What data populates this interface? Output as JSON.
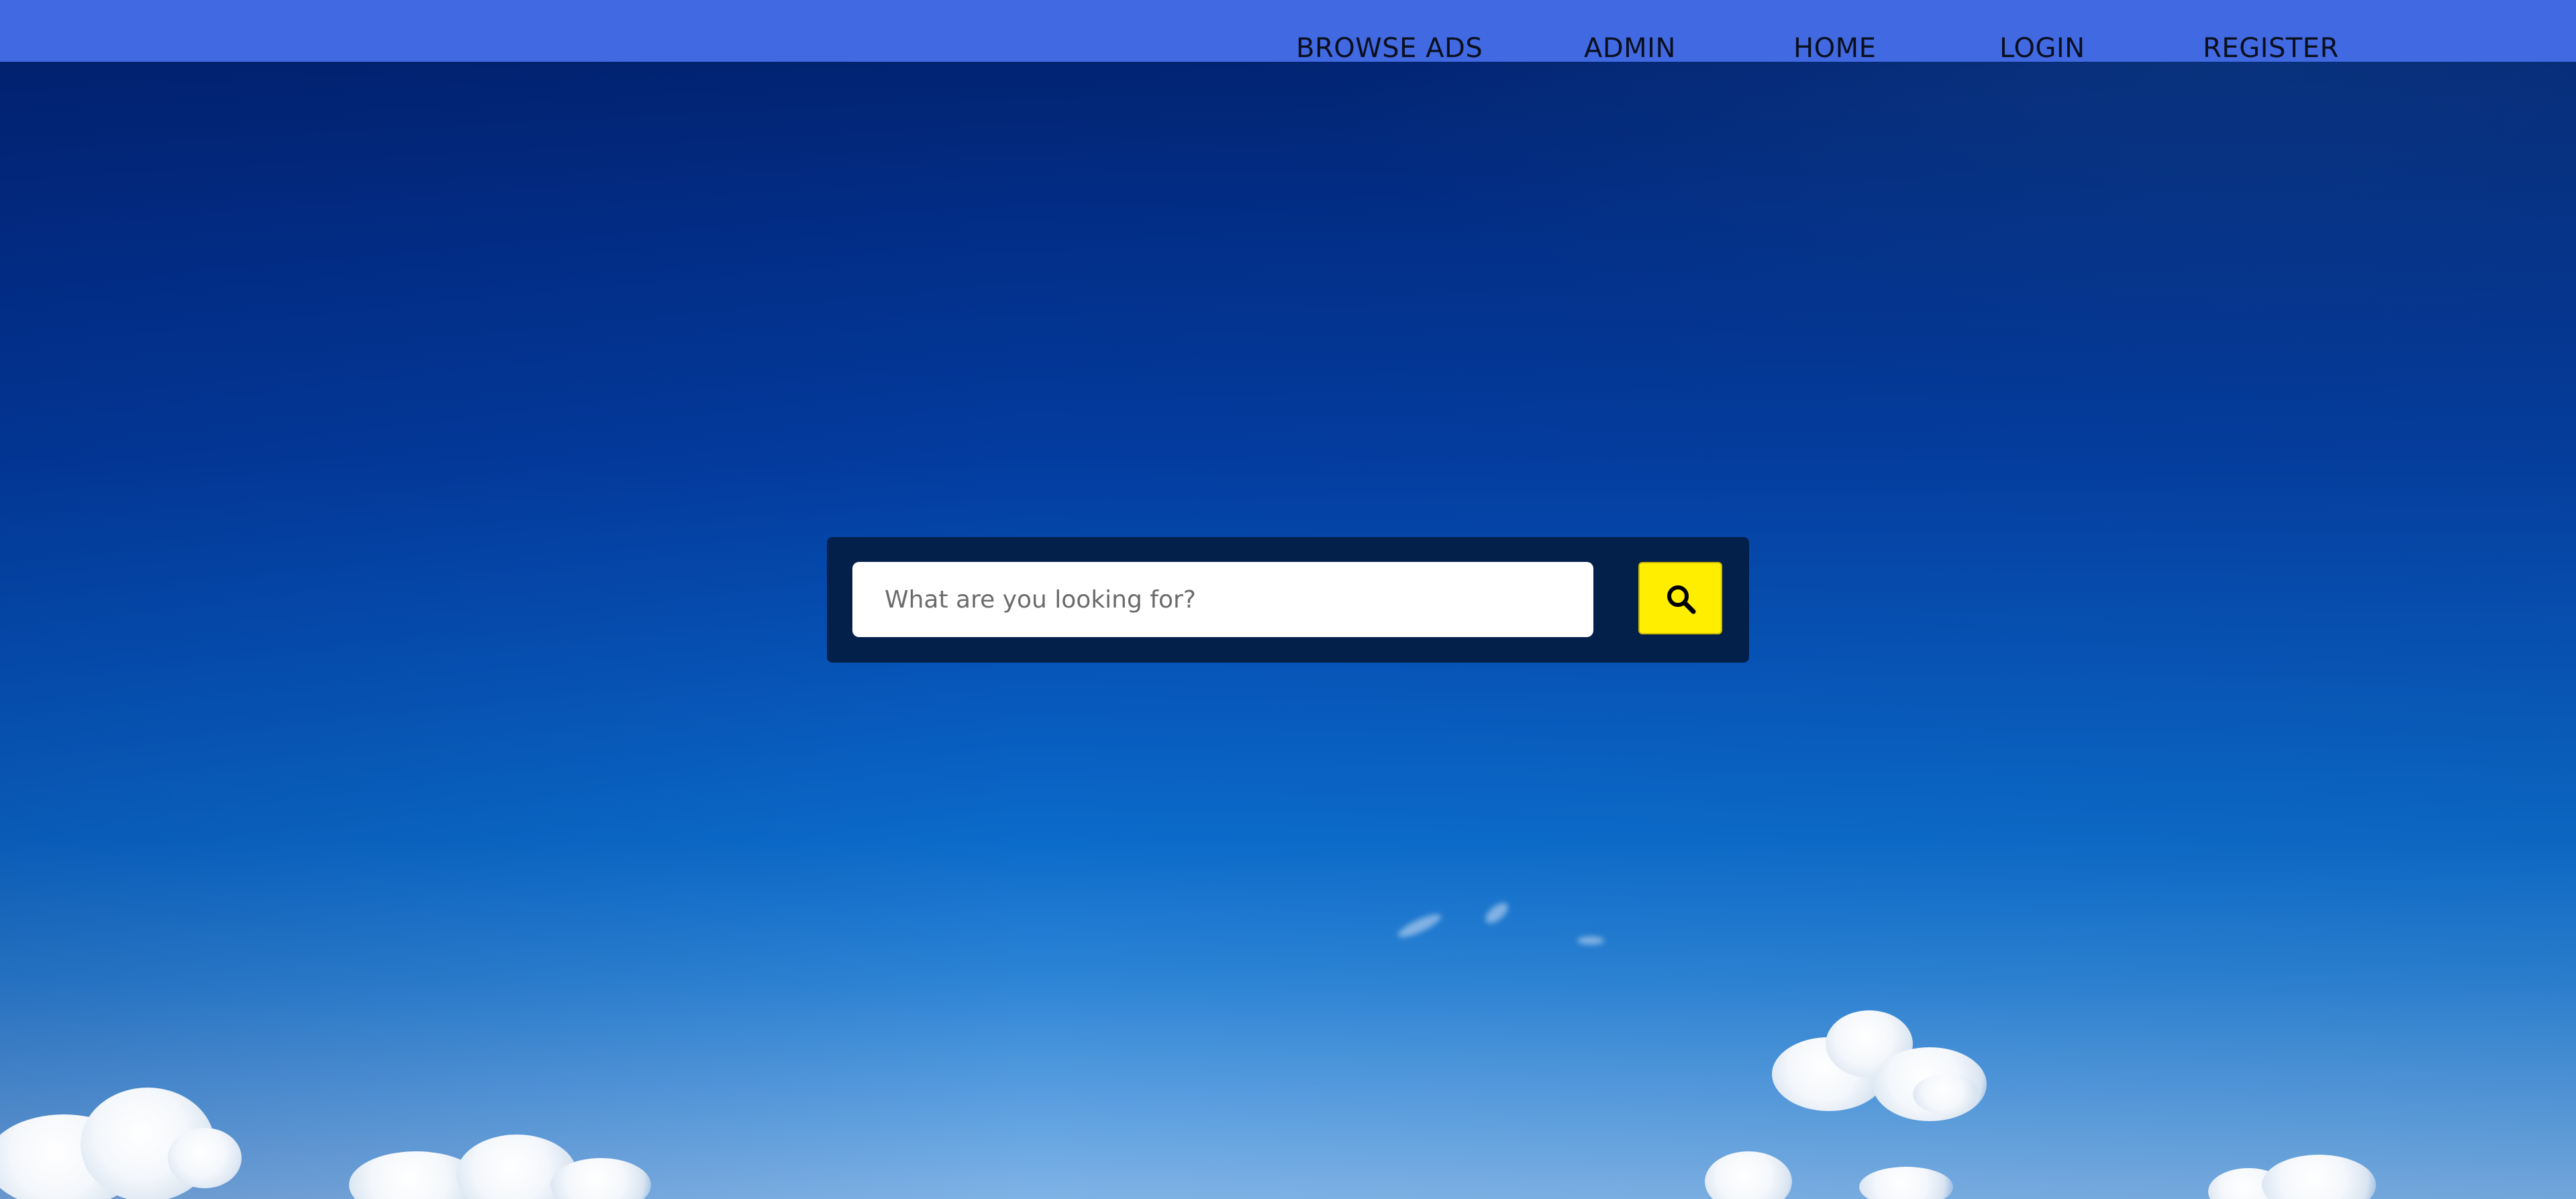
{
  "nav": {
    "items": [
      {
        "label": "BROWSE ADS"
      },
      {
        "label": "ADMIN"
      },
      {
        "label": "HOME"
      },
      {
        "label": "LOGIN"
      },
      {
        "label": "REGISTER"
      }
    ]
  },
  "search": {
    "placeholder": "What are you looking for?",
    "value": "",
    "button_icon": "search-icon"
  },
  "colors": {
    "navbar": "#4169e1",
    "search_panel": "#03204a",
    "search_button": "#ffee00"
  }
}
